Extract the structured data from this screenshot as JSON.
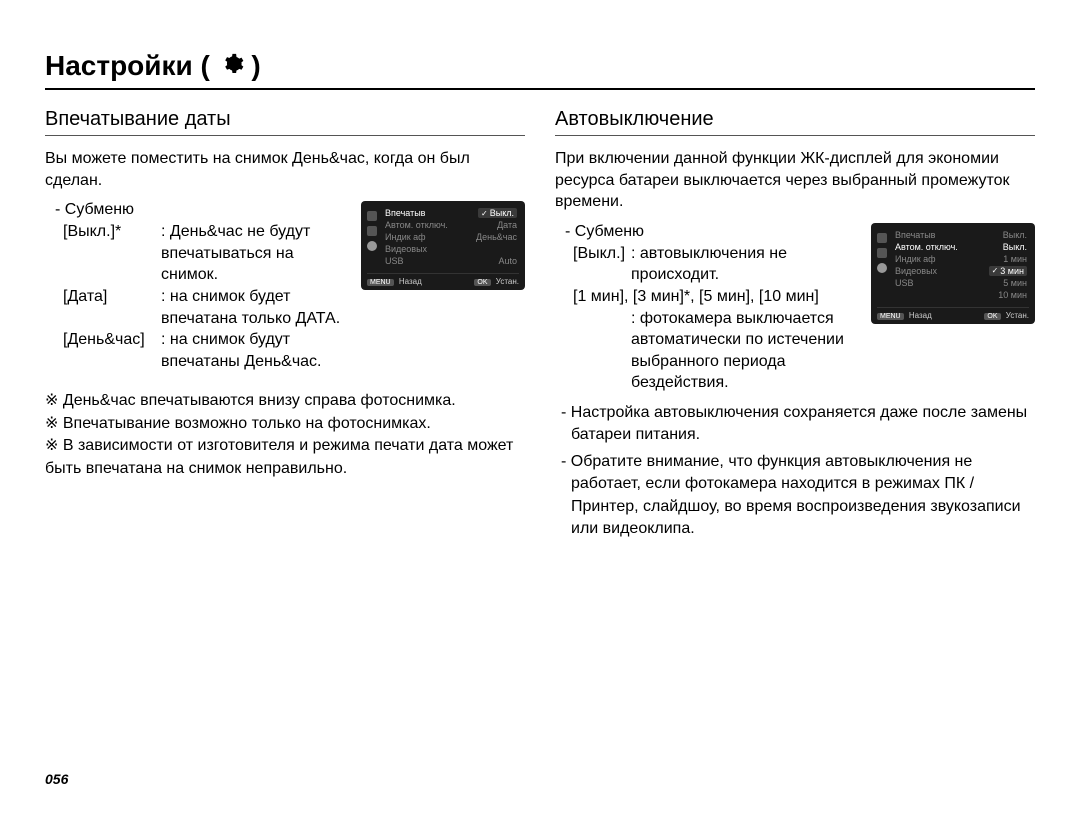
{
  "page": {
    "title_prefix": "Настройки",
    "title_open_paren": " ( ",
    "title_close_paren": " )",
    "number": "056"
  },
  "left": {
    "heading": "Впечатывание даты",
    "intro": "Вы можете поместить на снимок День&час, когда он был сделан.",
    "submenu_label": "- Субменю",
    "options": [
      {
        "key": "[Выкл.]*",
        "val": ": День&час не будут впечатываться на снимок."
      },
      {
        "key": "[Дата]",
        "val": ": на снимок будет впечатана только ДАТА."
      },
      {
        "key": "[День&час]",
        "val": ": на снимок будут впечатаны День&час."
      }
    ],
    "notes": [
      "※ День&час впечатываются внизу справа фотоснимка.",
      "※ Впечатывание возможно только на фотоснимках.",
      "※ В зависимости от изготовителя и режима печати дата может быть впечатана на снимок неправильно."
    ],
    "screen": {
      "rows": [
        {
          "l": "Впечатыв",
          "r": "Выкл.",
          "sel": true,
          "active": true
        },
        {
          "l": "Автом. отключ.",
          "r": "Дата"
        },
        {
          "l": "Индик аф",
          "r": "День&час"
        },
        {
          "l": "Видеовых",
          "r": ""
        },
        {
          "l": "USB",
          "r": "Auto"
        }
      ],
      "footer_back_btn": "MENU",
      "footer_back": "Назад",
      "footer_ok_btn": "OK",
      "footer_ok": "Устан."
    }
  },
  "right": {
    "heading": "Автовыключение",
    "intro": "При включении данной функции ЖК-дисплей для экономии ресурса батареи выключается через выбранный промежуток времени.",
    "submenu_label": "- Субменю",
    "opt_off_key": "[Выкл.]",
    "opt_off_val": ": автовыключения не происходит.",
    "opt_times_line": "[1 мин], [3 мин]*, [5 мин], [10 мин]",
    "opt_times_val": ": фотокамера выключается автоматически по истечении выбранного периода бездействия.",
    "bullets": [
      "- Настройка автовыключения сохраняется даже после замены батареи питания.",
      "- Обратите внимание, что функция автовыключения не работает, если фотокамера находится в режимах ПК / Принтер, слайдшоу, во время воспроизведения звукозаписи или видеоклипа."
    ],
    "screen": {
      "rows": [
        {
          "l": "Впечатыв",
          "r": "Выкл."
        },
        {
          "l": "Автом. отключ.",
          "r": "Выкл.",
          "active": true
        },
        {
          "l": "Индик аф",
          "r": "1 мин"
        },
        {
          "l": "Видеовых",
          "r": "3 мин",
          "sel": true
        },
        {
          "l": "USB",
          "r": "5 мин"
        },
        {
          "l": "",
          "r": "10 мин"
        }
      ],
      "footer_back_btn": "MENU",
      "footer_back": "Назад",
      "footer_ok_btn": "OK",
      "footer_ok": "Устан."
    }
  }
}
